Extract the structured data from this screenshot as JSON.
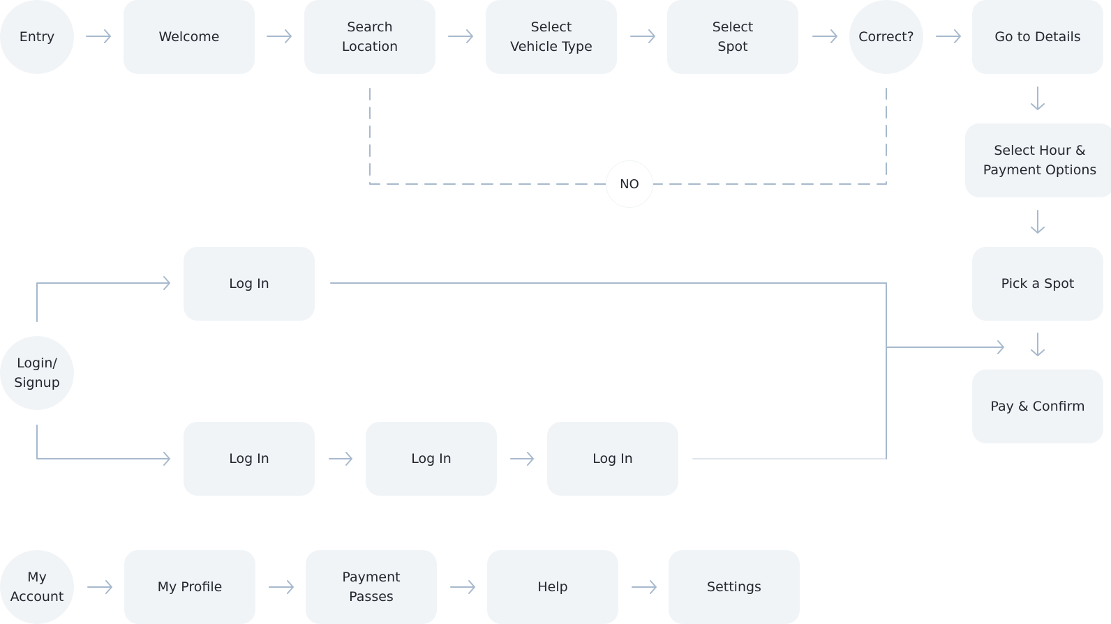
{
  "diagram": {
    "title_visible": false,
    "colors": {
      "node_fill": "#f1f4f7",
      "connector": "#a7b9cd",
      "text": "#22262e"
    },
    "nodes": {
      "entry": "Entry",
      "welcome": "Welcome",
      "search_location": "Search\nLocation",
      "select_vehicle_type": "Select\nVehicle Type",
      "select_spot": "Select\nSpot",
      "correct": "Correct?",
      "go_to_details": "Go to Details",
      "select_hour_payment": "Select Hour &\nPayment Options",
      "pick_a_spot": "Pick a Spot",
      "pay_confirm": "Pay & Confirm",
      "login_signup": "Login/\nSignup",
      "login_top": "Log In",
      "login_bottom_1": "Log In",
      "login_bottom_2": "Log In",
      "login_bottom_3": "Log In",
      "my_account": "My\nAccount",
      "my_profile": "My Profile",
      "payment_passes": "Payment\nPasses",
      "help": "Help",
      "settings": "Settings"
    },
    "decision_label": "NO",
    "edges": [
      [
        "entry",
        "welcome"
      ],
      [
        "welcome",
        "search_location"
      ],
      [
        "search_location",
        "select_vehicle_type"
      ],
      [
        "select_vehicle_type",
        "select_spot"
      ],
      [
        "select_spot",
        "correct"
      ],
      [
        "correct",
        "go_to_details"
      ],
      [
        "go_to_details",
        "select_hour_payment"
      ],
      [
        "select_hour_payment",
        "pick_a_spot"
      ],
      [
        "pick_a_spot",
        "pay_confirm"
      ],
      [
        "correct",
        "search_location",
        "NO"
      ],
      [
        "login_signup",
        "login_top"
      ],
      [
        "login_signup",
        "login_bottom_1"
      ],
      [
        "login_bottom_1",
        "login_bottom_2"
      ],
      [
        "login_bottom_2",
        "login_bottom_3"
      ],
      [
        "login_top",
        "pay_confirm"
      ],
      [
        "login_bottom_3",
        "pay_confirm"
      ],
      [
        "my_account",
        "my_profile"
      ],
      [
        "my_profile",
        "payment_passes"
      ],
      [
        "payment_passes",
        "help"
      ],
      [
        "help",
        "settings"
      ]
    ]
  }
}
